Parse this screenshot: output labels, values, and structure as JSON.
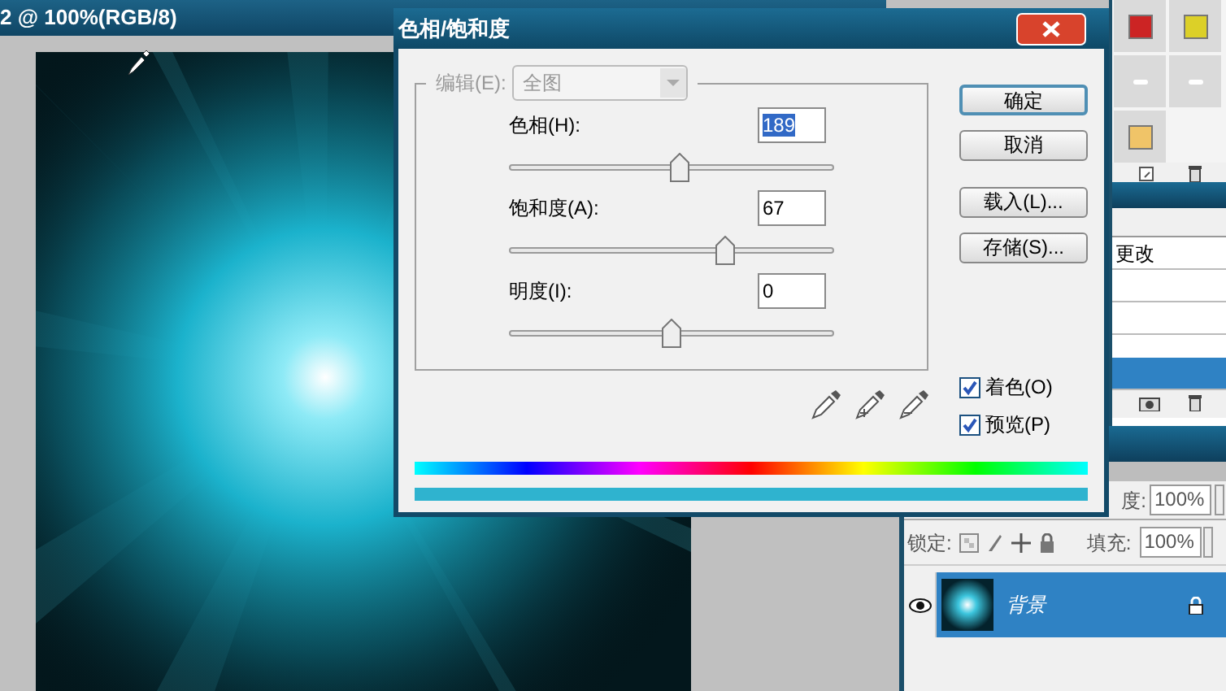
{
  "document": {
    "title": "2 @ 100%(RGB/8)"
  },
  "swatches": [
    {
      "kind": "square",
      "color": "#cc2424"
    },
    {
      "kind": "square",
      "color": "#dcd028"
    },
    {
      "kind": "dash",
      "color": "#ffffff"
    },
    {
      "kind": "dash",
      "color": "#ffffff"
    },
    {
      "kind": "square",
      "color": "#f0c468"
    }
  ],
  "history": {
    "items": [
      {
        "label": "更改",
        "selected": false
      },
      {
        "selected": true
      }
    ]
  },
  "layers": {
    "opacity_label": "度:",
    "opacity": "100%",
    "lock_label": "锁定:",
    "fill_label": "填充:",
    "fill": "100%",
    "items": [
      {
        "name": "背景",
        "selected": true,
        "visible": true,
        "locked": true
      }
    ]
  },
  "dialog": {
    "title": "色相/饱和度",
    "edit": {
      "label": "编辑(E):",
      "value": "全图",
      "disabled": true
    },
    "sliders": [
      {
        "label": "色相(H):",
        "value": "189",
        "selected": true,
        "level": 0.525
      },
      {
        "label": "饱和度(A):",
        "value": "67",
        "selected": false,
        "level": 0.665
      },
      {
        "label": "明度(I):",
        "value": "0",
        "selected": false,
        "level": 0.5
      }
    ],
    "buttons": [
      {
        "label": "确定",
        "default": true
      },
      {
        "label": "取消",
        "default": false
      },
      {
        "label": "载入(L)...",
        "default": false
      },
      {
        "label": "存储(S)...",
        "default": false
      }
    ],
    "checkboxes": [
      {
        "label": "着色(O)",
        "checked": true
      },
      {
        "label": "预览(P)",
        "checked": true
      }
    ]
  }
}
